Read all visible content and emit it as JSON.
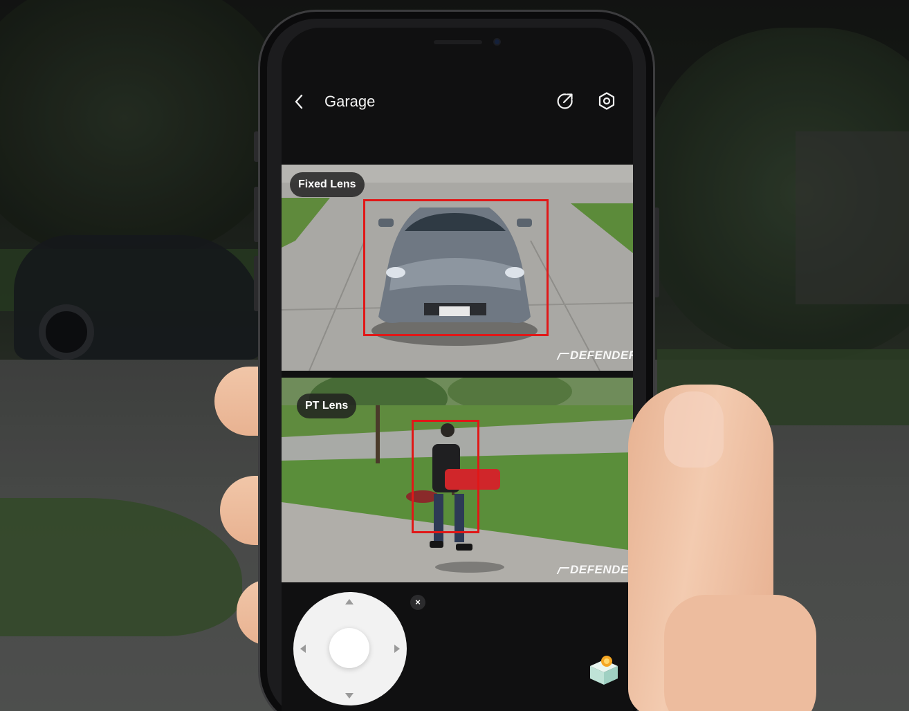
{
  "header": {
    "title": "Garage",
    "back_icon": "chevron-left-icon",
    "share_icon": "share-arrow-icon",
    "settings_icon": "gear-icon"
  },
  "feeds": [
    {
      "label": "Fixed Lens",
      "brand": "DEFENDER",
      "detection": "vehicle"
    },
    {
      "label": "PT Lens",
      "brand": "DEFENDER",
      "detection": "person"
    }
  ],
  "controls": {
    "close_label": "×",
    "joystick_icon": "ptz-joystick-icon",
    "extra_icon": "cube-box-icon"
  },
  "colors": {
    "detection_box": "#e11717",
    "screen_bg": "#101011",
    "header_text": "#f2f2f2"
  }
}
